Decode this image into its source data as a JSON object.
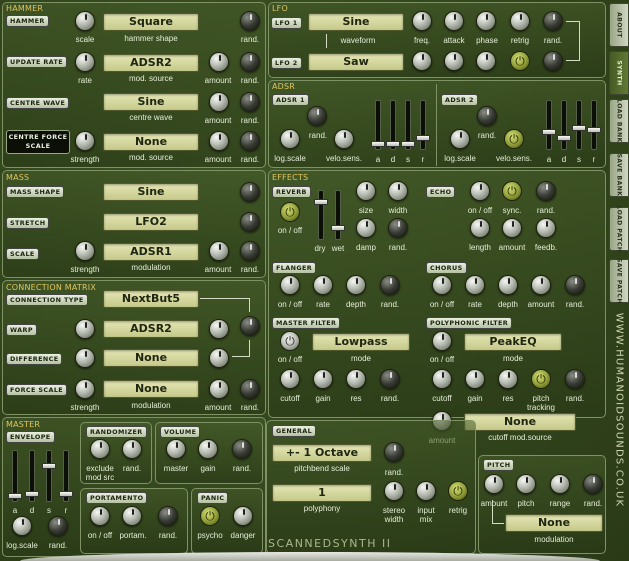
{
  "tabs": [
    "ABOUT",
    "SYNTH",
    "LOAD BANK",
    "SAVE BANK",
    "LOAD PATCH",
    "SAVE PATCH"
  ],
  "active_tab": "SYNTH",
  "website": "WWW.HUMANOIDSOUNDS.CO.UK",
  "brand": "SCANNEDSYNTH II",
  "hammer": {
    "title": "HAMMER",
    "rows": [
      {
        "tag": "HAMMER",
        "lcd": "Square",
        "k1": "scale",
        "lcd_label": "hammer shape",
        "k3": "rand."
      },
      {
        "tag": "UPDATE RATE",
        "lcd": "ADSR2",
        "k1": "rate",
        "lcd_label": "mod. source",
        "k2": "amount",
        "k3": "rand."
      },
      {
        "tag": "CENTRE WAVE",
        "lcd": "Sine",
        "lcd_label": "centre wave",
        "k2": "amount",
        "k3": "rand."
      },
      {
        "tag1": "CENTRE FORCE",
        "tag2": "SCALE",
        "lcd": "None",
        "k1": "strength",
        "lcd_label": "mod. source",
        "k2": "amount",
        "k3": "rand."
      }
    ]
  },
  "mass": {
    "title": "MASS",
    "rows": [
      {
        "tag": "MASS SHAPE",
        "lcd": "Sine"
      },
      {
        "tag": "STRETCH",
        "lcd": "LFO2"
      },
      {
        "tag": "SCALE",
        "lcd": "ADSR1",
        "k1": "strength",
        "lcd_label": "modulation",
        "k2": "amount",
        "k3": "rand."
      }
    ]
  },
  "connection": {
    "title": "CONNECTION MATRIX",
    "rows": [
      {
        "tag": "CONNECTION TYPE",
        "lcd": "NextBut5"
      },
      {
        "tag": "WARP",
        "lcd": "ADSR2"
      },
      {
        "tag": "DIFFERENCE",
        "lcd": "None"
      },
      {
        "tag": "FORCE SCALE",
        "lcd": "None",
        "k1": "strength",
        "lcd_label": "modulation",
        "k2": "amount",
        "k3": "rand."
      }
    ]
  },
  "lfo": {
    "title": "LFO",
    "lfo1_tag": "LFO 1",
    "lfo1_wave": "Sine",
    "lfo2_tag": "LFO 2",
    "lfo2_wave": "Saw",
    "waveform": "waveform",
    "knobs": [
      "freq.",
      "attack",
      "phase",
      "retrig",
      "rand."
    ]
  },
  "adsr": {
    "title": "ADSR",
    "adsr1": {
      "tag": "ADSR 1",
      "rand": "rand.",
      "logscale": "log.scale",
      "velo": "velo.sens.",
      "sliders": [
        "a",
        "d",
        "s",
        "r"
      ]
    },
    "adsr2": {
      "tag": "ADSR 2",
      "rand": "rand.",
      "logscale": "log.scale",
      "velo": "velo.sens.",
      "sliders": [
        "a",
        "d",
        "s",
        "r"
      ]
    }
  },
  "effects": {
    "title": "EFFECTS",
    "reverb": {
      "tag": "REVERB",
      "onoff": "on / off",
      "dry": "dry",
      "wet": "wet",
      "size": "size",
      "width": "width",
      "damp": "damp",
      "rand": "rand."
    },
    "echo": {
      "tag": "ECHO",
      "onoff": "on / off",
      "sync": "sync.",
      "rand": "rand.",
      "length": "length",
      "amount": "amount",
      "feedb": "feedb."
    },
    "flanger": {
      "tag": "FLANGER",
      "labels": [
        "on / off",
        "rate",
        "depth",
        "rand."
      ]
    },
    "chorus": {
      "tag": "CHORUS",
      "labels": [
        "on / off",
        "rate",
        "depth",
        "amount",
        "rand."
      ]
    },
    "master_filter": {
      "tag": "MASTER FILTER",
      "onoff": "on / off",
      "lcd": "Lowpass",
      "mode": "mode",
      "knobs": [
        "cutoff",
        "gain",
        "res",
        "rand."
      ]
    },
    "poly_filter": {
      "tag": "POLYPHONIC FILTER",
      "onoff": "on / off",
      "lcd": "PeakEQ",
      "mode": "mode",
      "knobs": [
        "cutoff",
        "gain",
        "res",
        "pitch",
        "tracking",
        "rand."
      ],
      "amount": "amount",
      "lcd2": "None",
      "lcd2_label": "cutoff mod.source"
    }
  },
  "master": {
    "title": "MASTER",
    "envelope": {
      "tag": "ENVELOPE",
      "sliders": [
        "a",
        "d",
        "s",
        "r"
      ],
      "logscale": "log.scale",
      "rand": "rand."
    },
    "randomizer": {
      "tag": "RANDOMIZER",
      "exclude": "exclude",
      "modsrc": "mod src",
      "rand": "rand."
    },
    "volume": {
      "tag": "VOLUME",
      "labels": [
        "master",
        "gain",
        "rand."
      ]
    },
    "portamento": {
      "tag": "PORTAMENTO",
      "labels": [
        "on / off",
        "portam.",
        "rand."
      ]
    },
    "panic": {
      "tag": "PANIC",
      "labels": [
        "psycho",
        "danger"
      ]
    }
  },
  "general": {
    "tag": "GENERAL",
    "pitchbend": "+- 1 Octave",
    "pitchbend_label": "pitchbend scale",
    "rand": "rand.",
    "polyphony": "1",
    "polyphony_label": "polyphony",
    "stereo": "stereo",
    "width": "width",
    "input": "input",
    "mix": "mix",
    "retrig": "retrig"
  },
  "pitch": {
    "tag": "PITCH",
    "labels": [
      "amount",
      "pitch",
      "range",
      "rand."
    ],
    "lcd": "None",
    "lcd_label": "modulation"
  }
}
